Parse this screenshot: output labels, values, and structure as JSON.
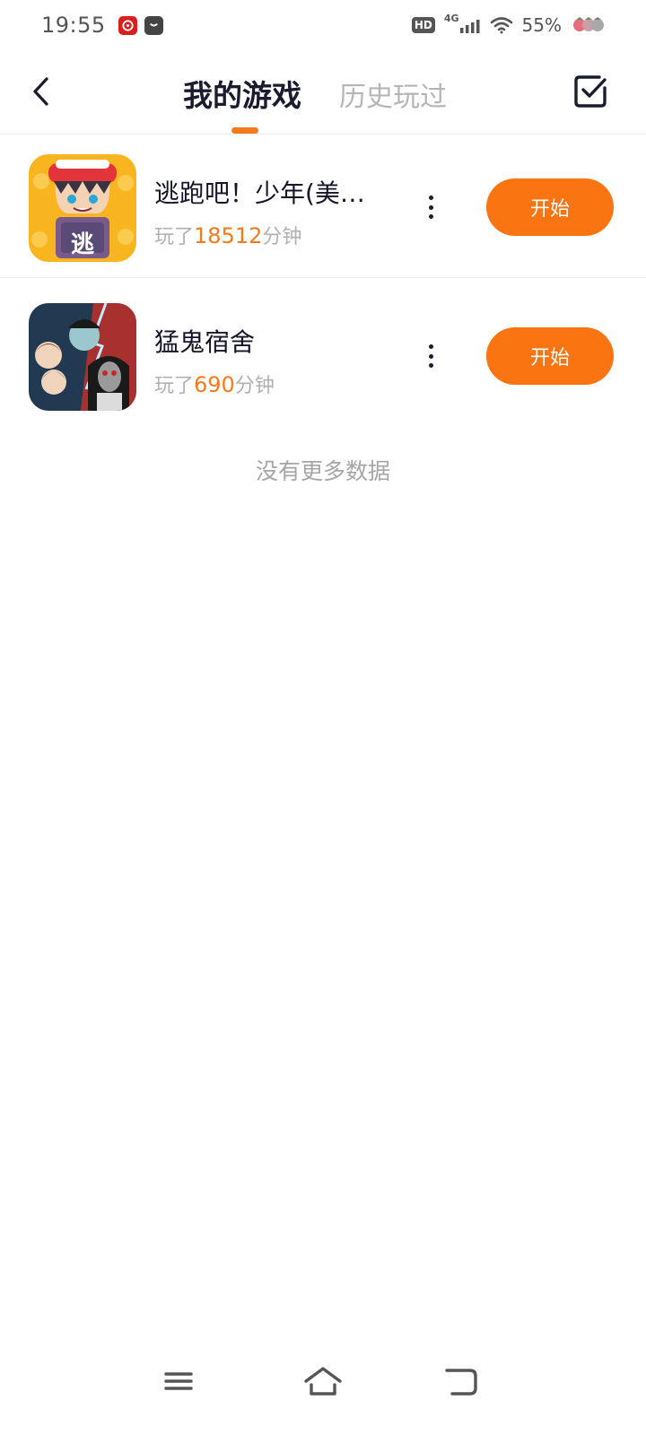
{
  "status_bar": {
    "time": "19:55",
    "hd": "HD",
    "network": "4G",
    "battery": "55%",
    "icons": [
      "netease-music-icon",
      "shopping-bag-icon",
      "hd-icon",
      "signal-icon",
      "wifi-icon",
      "carrot-icon"
    ]
  },
  "header": {
    "back_icon": "chevron-left-icon",
    "tabs": [
      {
        "label": "我的游戏",
        "active": true
      },
      {
        "label": "历史玩过",
        "active": false
      }
    ],
    "manage_icon": "checkbox-icon",
    "accent_color": "#f57a1d"
  },
  "games": [
    {
      "name": "逃跑吧！少年(美…",
      "played_prefix": "玩了",
      "minutes": "18512",
      "played_suffix": "分钟",
      "icon_text": "逃",
      "more_icon": "vertical-dots-icon",
      "start_label": "开始"
    },
    {
      "name": "猛鬼宿舍",
      "played_prefix": "玩了",
      "minutes": "690",
      "played_suffix": "分钟",
      "more_icon": "vertical-dots-icon",
      "start_label": "开始"
    }
  ],
  "footer_text": "没有更多数据",
  "nav_bar": {
    "icons": [
      "menu-icon",
      "home-icon",
      "back-icon"
    ]
  }
}
